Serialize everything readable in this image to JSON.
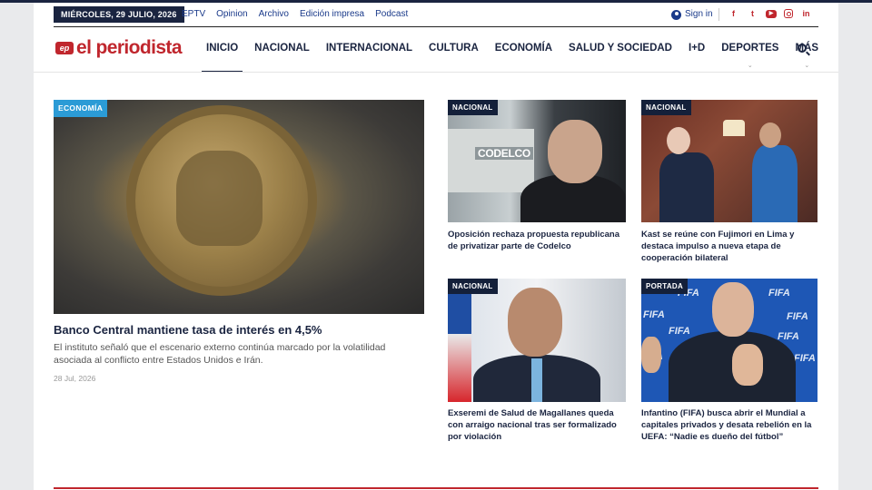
{
  "topbar": {
    "date": "MIÉRCOLES, 29 JULIO, 2026",
    "links": [
      "EPTV",
      "Opinion",
      "Archivo",
      "Edición impresa",
      "Podcast"
    ],
    "signin": "Sign in",
    "socials": [
      "facebook-icon",
      "twitter-icon",
      "youtube-icon",
      "instagram-icon",
      "linkedin-icon"
    ]
  },
  "brand": {
    "mark": "ep",
    "name": "el periodista",
    "color": "#c0262d"
  },
  "nav": {
    "items": [
      "INICIO",
      "NACIONAL",
      "INTERNACIONAL",
      "CULTURA",
      "ECONOMÍA",
      "SALUD Y SOCIEDAD",
      "I+D",
      "DEPORTES",
      "MÁS"
    ],
    "active": "INICIO"
  },
  "main": {
    "tag": "ECONOMÍA",
    "title": "Banco Central mantiene tasa de interés en 4,5%",
    "description": "El instituto señaló que el escenario externo continúa marcado por la volatilidad asociada al conflicto entre Estados Unidos e Irán.",
    "date": "28 Jul, 2026"
  },
  "cards": [
    {
      "tag": "NACIONAL",
      "title": "Oposición rechaza propuesta republicana de privatizar parte de Codelco",
      "image_text": "CODELCO"
    },
    {
      "tag": "NACIONAL",
      "title": "Kast se reúne con Fujimori en Lima y destaca impulso a nueva etapa de cooperación bilateral"
    },
    {
      "tag": "NACIONAL",
      "title": "Exseremi de Salud de Magallanes queda con arraigo nacional tras ser formalizado por violación"
    },
    {
      "tag": "PORTADA",
      "title": "Infantino (FIFA) busca abrir el Mundial a capitales privados y desata rebelión en la UEFA: “Nadie es dueño del fútbol”",
      "image_text": "FIFA"
    }
  ]
}
